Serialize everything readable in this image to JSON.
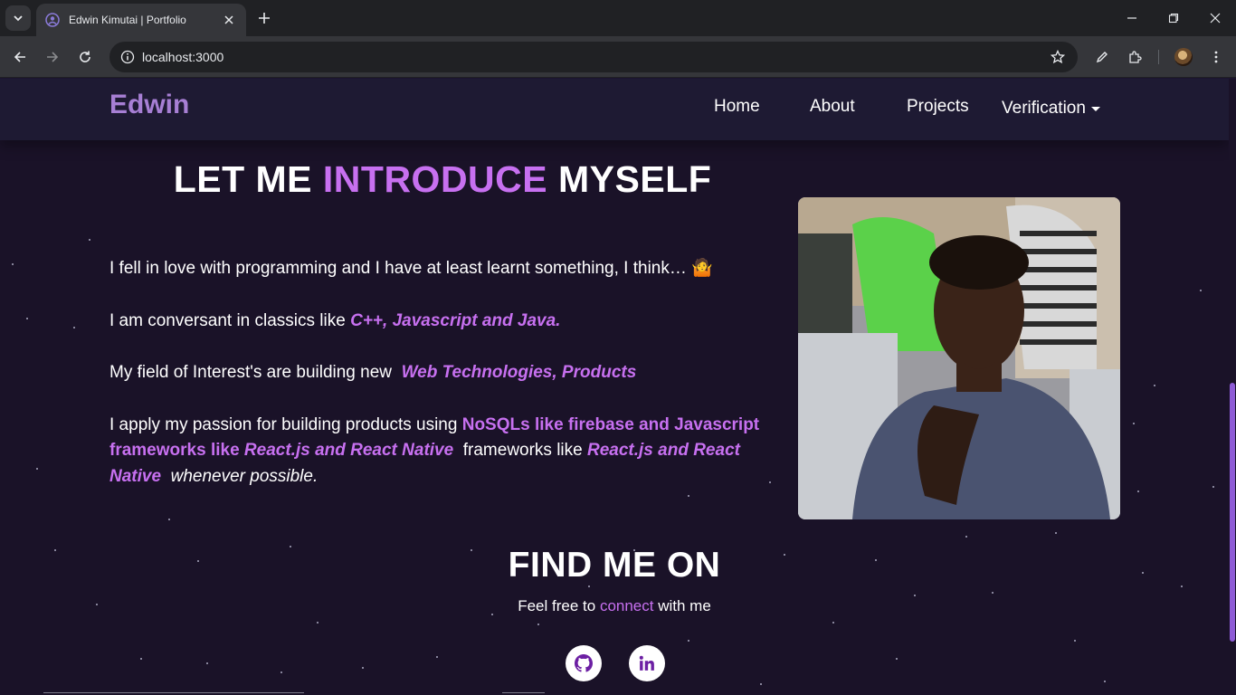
{
  "browser": {
    "tab_title": "Edwin Kimutai | Portfolio",
    "url": "localhost:3000"
  },
  "navbar": {
    "brand": "Edwin",
    "links": [
      "Home",
      "About",
      "Projects"
    ],
    "dropdown": "Verification"
  },
  "intro": {
    "heading_pre": "LET ME ",
    "heading_highlight": "INTRODUCE",
    "heading_post": " MYSELF",
    "p1": "I fell in love with programming and I have at least learnt something, I think… 🤷",
    "p2_pre": "I am conversant in classics like ",
    "p2_highlight": "C++, Javascript and Java.",
    "p3_pre": "My field of Interest's are building new ",
    "p3_highlight": "Web Technologies, Products",
    "p4_pre": "I apply my passion for building products using ",
    "p4_highlight1": "NoSQLs like firebase and Javascript frameworks like ",
    "p4_highlight1_i": "React.js and React Native",
    "p4_mid": " frameworks like ",
    "p4_highlight2": "React.js and React Native",
    "p4_end": " whenever possible."
  },
  "find": {
    "heading": "FIND ME ON",
    "sub_pre": "Feel free to ",
    "sub_highlight": "connect",
    "sub_post": " with me"
  },
  "colors": {
    "accent": "#c770f0",
    "brand": "#a77fd4",
    "background": "#1a1228"
  }
}
